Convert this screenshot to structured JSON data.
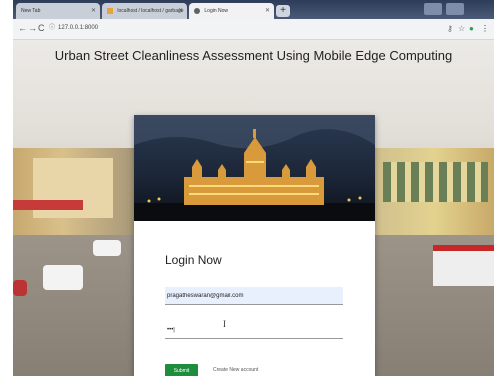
{
  "browser": {
    "tabs": [
      {
        "label": "New Tab",
        "active": false
      },
      {
        "label": "localhost / localhost / garbage",
        "active": false
      },
      {
        "label": "Login Now",
        "active": true
      }
    ],
    "new_tab_label": "+",
    "address_url": "127.0.0.1:8000"
  },
  "page": {
    "title": "Urban Street Cleanliness Assessment Using Mobile Edge Computing"
  },
  "login": {
    "heading": "Login Now",
    "email_value": "pragatheswaran@gmail.com",
    "password_value": "•••|",
    "submit_label": "Submit",
    "register_text": "Create New account"
  },
  "colors": {
    "submit": "#1e8e3e",
    "tabbar": "#2d3c58",
    "email_autofill": "#e8f0fe"
  },
  "icons": [
    "back-icon",
    "forward-icon",
    "reload-icon",
    "info-icon",
    "key-icon",
    "star-icon",
    "extension-icon",
    "menu-icon"
  ]
}
